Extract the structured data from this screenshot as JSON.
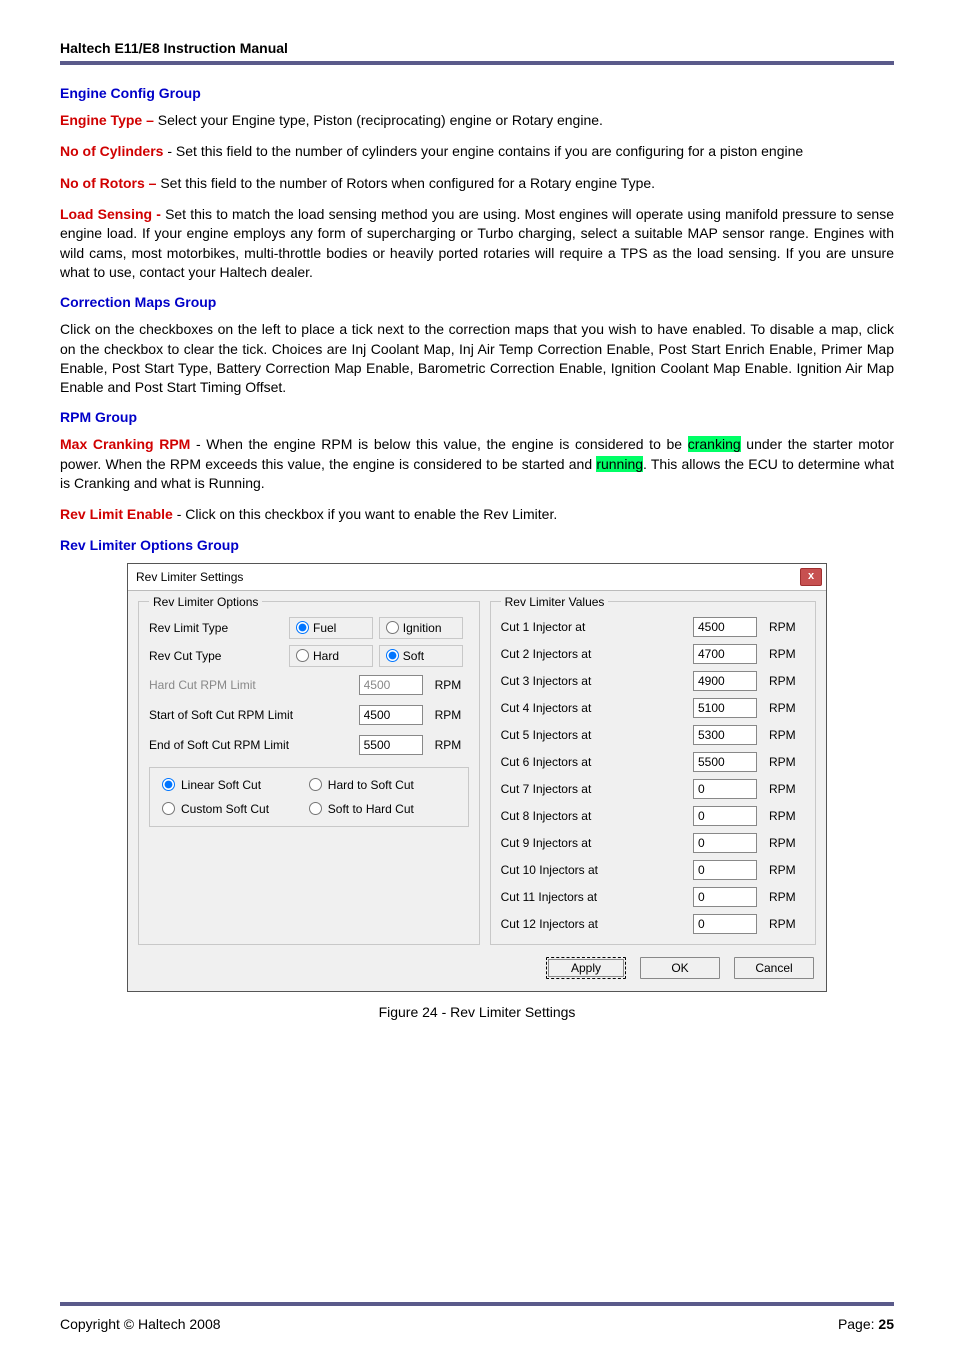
{
  "header": {
    "title": "Haltech E11/E8 Instruction Manual"
  },
  "engine_config": {
    "heading": "Engine Config Group",
    "engine_type": {
      "label": "Engine Type – ",
      "text": "Select  your Engine type,  Piston (reciprocating) engine or Rotary engine."
    },
    "no_cylinders": {
      "label": "No of Cylinders ",
      "text": "- Set this field to the number of cylinders your engine contains if you are configuring for a piston engine"
    },
    "no_rotors": {
      "label": "No of Rotors – ",
      "text": "Set this field to the number of Rotors when configured for a Rotary engine Type."
    },
    "load_sensing": {
      "label": "Load Sensing - ",
      "text": "Set this to match the load sensing method you are using. Most engines will operate using manifold pressure to sense engine load. If your engine employs any form of supercharging or Turbo charging, select a suitable MAP sensor range. Engines with wild cams, most motorbikes, multi-throttle bodies or heavily ported rotaries will require a TPS as the load sensing. If you are unsure what to use, contact your Haltech dealer."
    }
  },
  "correction_maps": {
    "heading": "Correction Maps Group",
    "text": "Click on the checkboxes on the left to place a tick next to the correction maps that you wish to have enabled. To disable a map, click on the checkbox to clear the tick. Choices are Inj Coolant Map, Inj Air Temp Correction Enable, Post Start Enrich Enable, Primer Map Enable, Post Start Type, Battery Correction Map Enable, Barometric Correction Enable, Ignition Coolant Map Enable. Ignition Air Map Enable and Post Start Timing Offset."
  },
  "rpm_group": {
    "heading": "RPM Group",
    "max_cranking": {
      "label": "Max Cranking RPM",
      "pre": " - When the engine RPM is below this value, the engine is considered to be ",
      "hl1": "cranking",
      "mid": " under the starter motor power. When the RPM exceeds this value, the engine is considered to be started and ",
      "hl2": "running",
      "post": ". This allows the ECU to determine what is Cranking and what is Running."
    },
    "rev_limit_enable": {
      "label": "Rev Limit Enable",
      "text": " - Click on this checkbox if you want  to enable the Rev Limiter."
    }
  },
  "rev_limiter_options": {
    "heading": "Rev Limiter Options Group"
  },
  "dialog": {
    "title": "Rev Limiter Settings",
    "close": "x",
    "left_legend": "Rev Limiter Options",
    "right_legend": "Rev Limiter Values",
    "labels": {
      "rev_limit_type": "Rev Limit Type",
      "rev_cut_type": "Rev Cut Type",
      "fuel": "Fuel",
      "ignition": "Ignition",
      "hard": "Hard",
      "soft": "Soft",
      "hard_cut_limit": "Hard Cut RPM Limit",
      "start_soft": "Start of Soft Cut RPM Limit",
      "end_soft": "End of Soft Cut RPM Limit",
      "linear_soft": "Linear Soft Cut",
      "hard_to_soft": "Hard to Soft Cut",
      "custom_soft": "Custom Soft Cut",
      "soft_to_hard": "Soft to Hard Cut",
      "rpm_unit": "RPM"
    },
    "values": {
      "hard_cut": "4500",
      "start_soft": "4500",
      "end_soft": "5500"
    },
    "injectors": [
      {
        "label": "Cut 1 Injector at",
        "value": "4500"
      },
      {
        "label": "Cut 2 Injectors at",
        "value": "4700"
      },
      {
        "label": "Cut 3 Injectors at",
        "value": "4900"
      },
      {
        "label": "Cut 4 Injectors at",
        "value": "5100"
      },
      {
        "label": "Cut 5 Injectors at",
        "value": "5300"
      },
      {
        "label": "Cut 6 Injectors at",
        "value": "5500"
      },
      {
        "label": "Cut 7 Injectors at",
        "value": "0"
      },
      {
        "label": "Cut 8 Injectors at",
        "value": "0"
      },
      {
        "label": "Cut 9 Injectors at",
        "value": "0"
      },
      {
        "label": "Cut 10 Injectors at",
        "value": "0"
      },
      {
        "label": "Cut 11 Injectors at",
        "value": "0"
      },
      {
        "label": "Cut 12 Injectors at",
        "value": "0"
      }
    ],
    "buttons": {
      "apply": "Apply",
      "ok": "OK",
      "cancel": "Cancel"
    }
  },
  "figure_caption": "Figure 24 - Rev Limiter Settings",
  "footer": {
    "copyright": "Copyright © Haltech 2008",
    "page_label": "Page: ",
    "page_num": "25"
  }
}
